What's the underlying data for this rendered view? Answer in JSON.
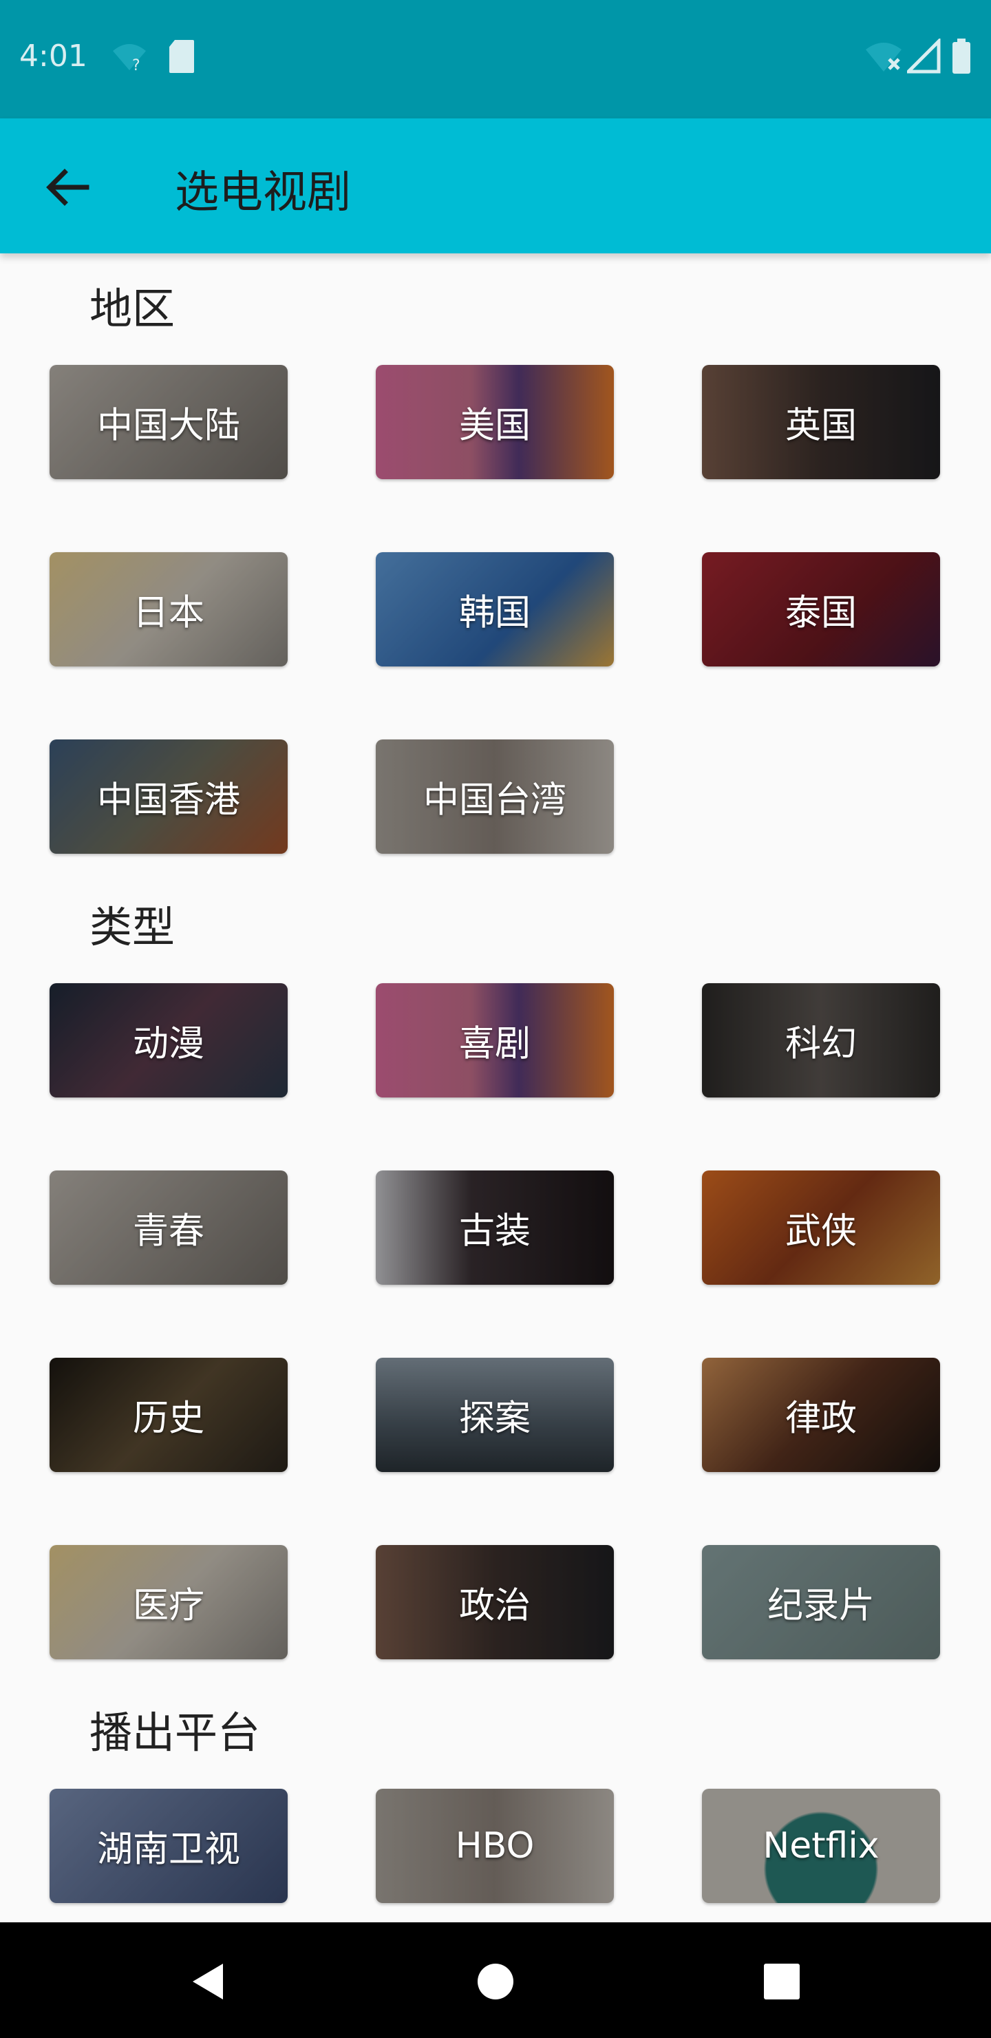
{
  "status_bar": {
    "time": "4:01",
    "icons_left": [
      "wifi-question-icon",
      "sd-card-icon"
    ],
    "icons_right": [
      "wifi-off-icon",
      "signal-icon",
      "battery-icon"
    ]
  },
  "app_bar": {
    "back_icon": "arrow-left-icon",
    "title": "选电视剧"
  },
  "sections": [
    {
      "title": "地区",
      "items": [
        {
          "label": "中国大陆",
          "bg": "#9a9690"
        },
        {
          "label": "美国",
          "bg": "#b56a7e"
        },
        {
          "label": "英国",
          "bg": "#5a4c46"
        },
        {
          "label": "日本",
          "bg": "#c9b98e"
        },
        {
          "label": "韩国",
          "bg": "#3c78b8"
        },
        {
          "label": "泰国",
          "bg": "#7a1e24"
        },
        {
          "label": "中国香港",
          "bg": "#4d5b6e"
        },
        {
          "label": "中国台湾",
          "bg": "#9b948c"
        }
      ]
    },
    {
      "title": "类型",
      "items": [
        {
          "label": "动漫",
          "bg": "#2f3848"
        },
        {
          "label": "喜剧",
          "bg": "#b56a7e"
        },
        {
          "label": "科幻",
          "bg": "#3d3a37"
        },
        {
          "label": "青春",
          "bg": "#9a9690"
        },
        {
          "label": "古装",
          "bg": "#2a2628"
        },
        {
          "label": "武侠",
          "bg": "#9e4d24"
        },
        {
          "label": "历史",
          "bg": "#2f2a22"
        },
        {
          "label": "探案",
          "bg": "#4f5a62"
        },
        {
          "label": "律政",
          "bg": "#5e3b24"
        },
        {
          "label": "医疗",
          "bg": "#c9b98e"
        },
        {
          "label": "政治",
          "bg": "#5a4c46"
        },
        {
          "label": "纪录片",
          "bg": "#6e8280"
        }
      ]
    },
    {
      "title": "播出平台",
      "items": [
        {
          "label": "湖南卫视",
          "bg": "#5a6c8e"
        },
        {
          "label": "HBO",
          "bg": "#9b948c"
        },
        {
          "label": "Netflix",
          "bg": "#5f8a86"
        }
      ]
    }
  ],
  "nav_bar": {
    "back": "triangle-back-icon",
    "home": "circle-home-icon",
    "recents": "square-recents-icon"
  }
}
